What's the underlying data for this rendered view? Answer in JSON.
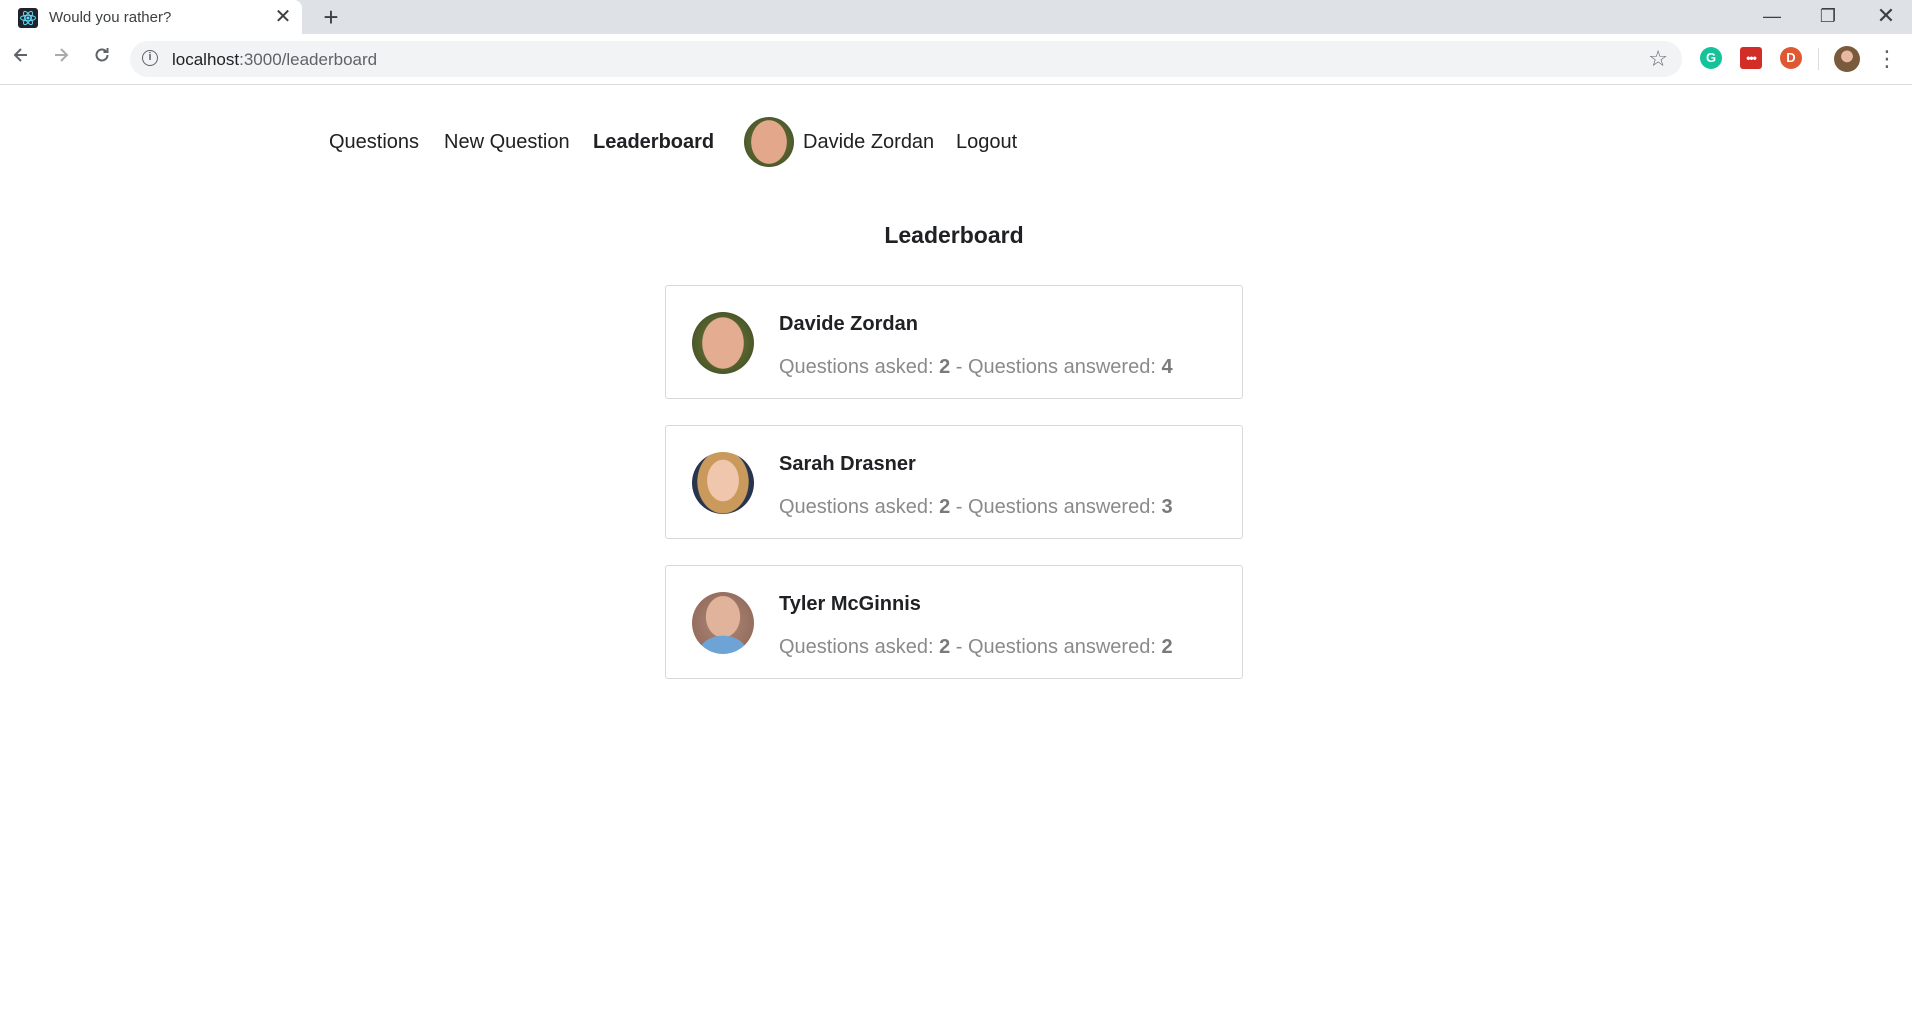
{
  "browser": {
    "tab_title": "Would you rather?",
    "tab_close": "✕",
    "new_tab": "+",
    "url_host": "localhost",
    "url_path": ":3000/leaderboard",
    "window_controls": {
      "minimize": "—",
      "maximize": "❐",
      "close": "✕"
    },
    "extensions": {
      "grammarly_letter": "G",
      "lastpass_text": "•••",
      "duckduckgo_letter": "D"
    }
  },
  "nav": {
    "questions": "Questions",
    "new_question": "New Question",
    "leaderboard": "Leaderboard",
    "user_name": "Davide Zordan",
    "logout": "Logout"
  },
  "page": {
    "title": "Leaderboard"
  },
  "stats_labels": {
    "asked": "Questions asked: ",
    "separator": " - ",
    "answered": "Questions answered: "
  },
  "leaders": [
    {
      "name": "Davide Zordan",
      "asked": "2",
      "answered": "4"
    },
    {
      "name": "Sarah Drasner",
      "asked": "2",
      "answered": "3"
    },
    {
      "name": "Tyler McGinnis",
      "asked": "2",
      "answered": "2"
    }
  ],
  "colors": {
    "card_border": "#d9d9d9",
    "stats_text": "#8a8a8a",
    "tabstrip": "#dee1e6",
    "omnibox": "#f1f3f4"
  },
  "icons": {
    "favicon": "react-logo-icon",
    "back": "arrow-left-icon",
    "forward": "arrow-right-icon",
    "reload": "reload-icon",
    "info": "info-icon",
    "star": "star-icon",
    "menu": "kebab-menu-icon"
  }
}
